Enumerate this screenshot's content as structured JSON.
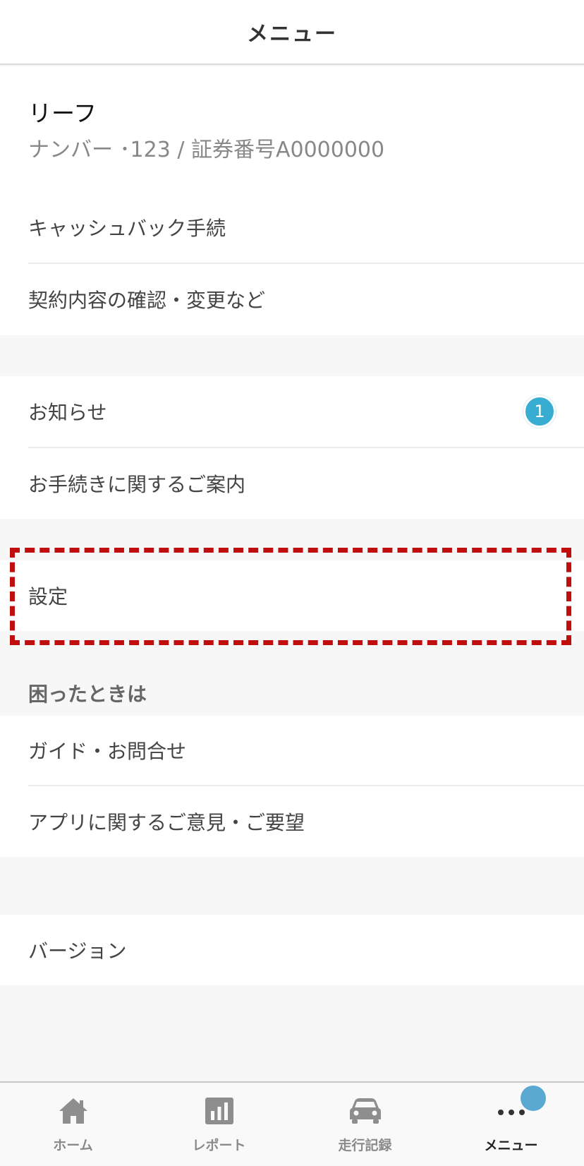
{
  "header": {
    "title": "メニュー"
  },
  "profile": {
    "name": "リーフ",
    "subtitle": "ナンバー ･123 / 証券番号A0000000"
  },
  "group1": {
    "items": [
      {
        "label": "キャッシュバック手続"
      },
      {
        "label": "契約内容の確認・変更など"
      }
    ]
  },
  "group2": {
    "items": [
      {
        "label": "お知らせ",
        "badge": "1"
      },
      {
        "label": "お手続きに関するご案内"
      }
    ]
  },
  "group3": {
    "items": [
      {
        "label": "設定"
      }
    ]
  },
  "help": {
    "title": "困ったときは",
    "items": [
      {
        "label": "ガイド・お問合せ"
      },
      {
        "label": "アプリに関するご意見・ご要望"
      }
    ]
  },
  "group5": {
    "items": [
      {
        "label": "バージョン"
      }
    ]
  },
  "tabbar": {
    "tabs": [
      {
        "label": "ホーム",
        "icon": "home-icon"
      },
      {
        "label": "レポート",
        "icon": "report-icon"
      },
      {
        "label": "走行記録",
        "icon": "car-icon"
      },
      {
        "label": "メニュー",
        "icon": "more-icon",
        "active": true
      }
    ]
  },
  "colors": {
    "accent": "#37aed1",
    "highlight_border": "#c00d0d",
    "background": "#f7f7f7"
  }
}
